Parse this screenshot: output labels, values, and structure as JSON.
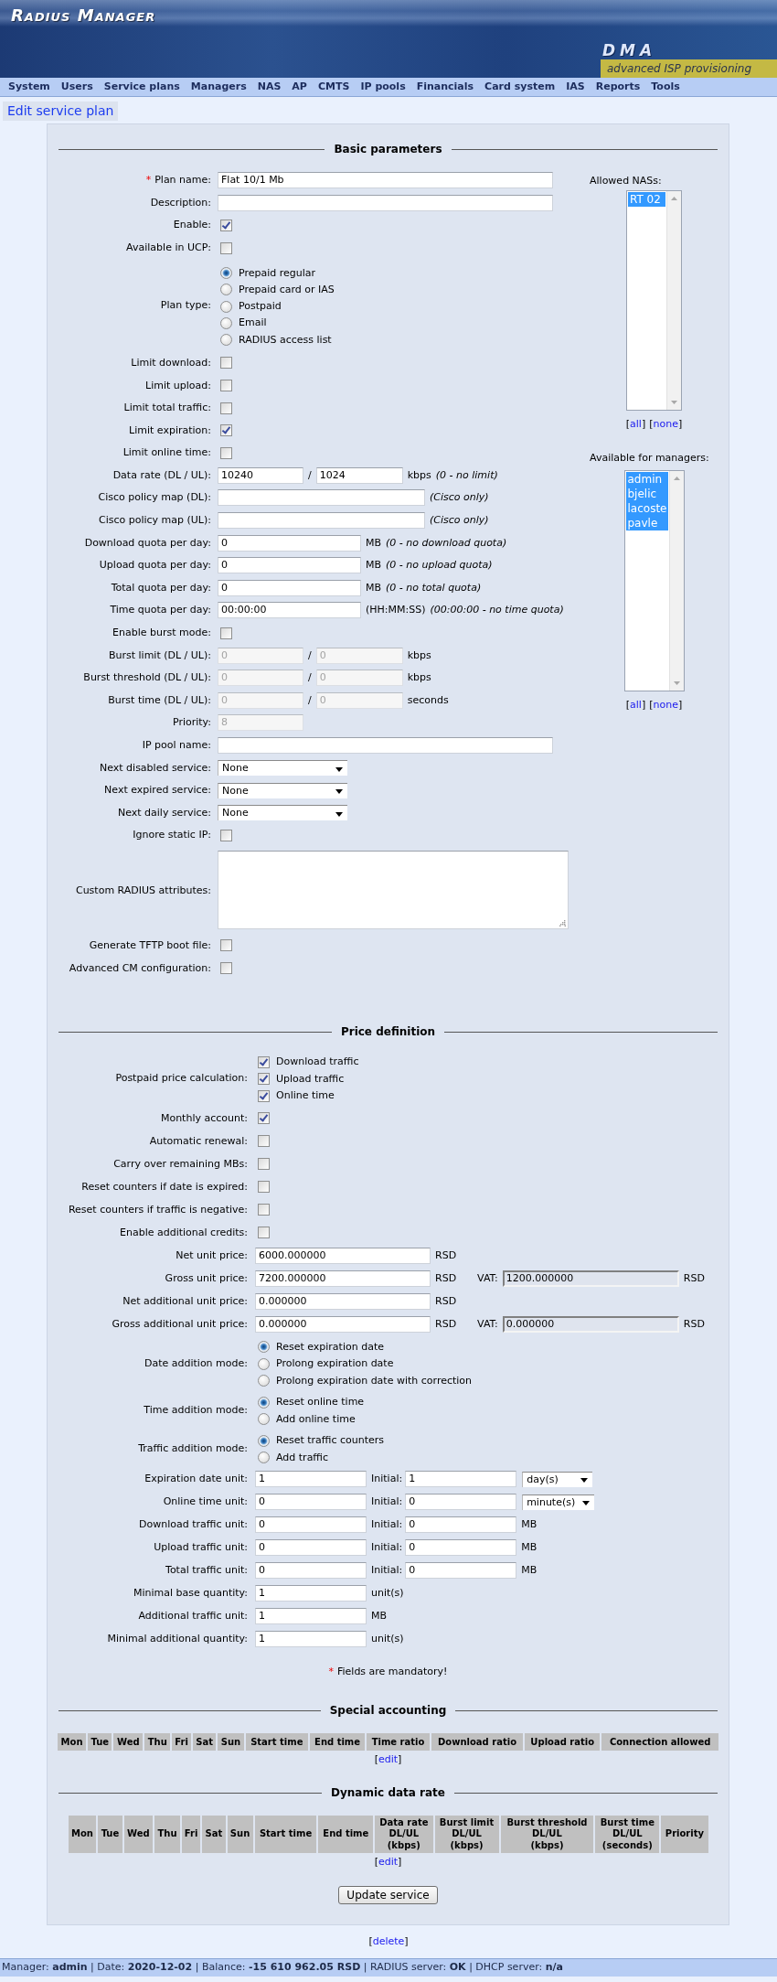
{
  "header": {
    "title": "Radius Manager",
    "logo": "DMA",
    "tagline": "advanced ISP provisioning"
  },
  "menu": [
    "System",
    "Users",
    "Service plans",
    "Managers",
    "NAS",
    "AP",
    "CMTS",
    "IP pools",
    "Financials",
    "Card system",
    "IAS",
    "Reports",
    "Tools"
  ],
  "page_title": "Edit service plan",
  "basic": {
    "heading": "Basic parameters",
    "rows": [
      {
        "kind": "wide",
        "label": "Plan name:",
        "mark": "*",
        "value": "Flat 10/1 Mb",
        "disabled": false
      },
      {
        "kind": "wide",
        "label": "Description:",
        "disabled": false
      },
      {
        "kind": "checkbox",
        "label": "Enable:",
        "checked": true,
        "disabled": false
      },
      {
        "kind": "checkbox",
        "label": "Available in UCP:",
        "checked": false,
        "disabled": false
      },
      {
        "kind": "radio",
        "label": "Plan type:",
        "disabled": false,
        "options": [
          {
            "label": "Prepaid regular",
            "selected": true
          },
          {
            "label": "Prepaid card or IAS",
            "selected": false
          },
          {
            "label": "Postpaid",
            "selected": false
          },
          {
            "label": "Email",
            "selected": false
          },
          {
            "label": "RADIUS access list",
            "selected": false
          }
        ]
      },
      {
        "kind": "checkbox",
        "label": "Limit download:",
        "checked": false,
        "disabled": false
      },
      {
        "kind": "checkbox",
        "label": "Limit upload:",
        "checked": false,
        "disabled": false
      },
      {
        "kind": "checkbox",
        "label": "Limit total traffic:",
        "checked": false,
        "disabled": false
      },
      {
        "kind": "checkbox",
        "label": "Limit expiration:",
        "checked": true,
        "disabled": false
      },
      {
        "kind": "checkbox",
        "label": "Limit online time:",
        "checked": false,
        "disabled": false
      },
      {
        "kind": "pair",
        "label": "Data rate (DL / UL):",
        "values": [
          "10240",
          "1024"
        ],
        "separator": "/",
        "unit": "kbps",
        "note": "(0 - no limit)",
        "disabled": false
      },
      {
        "kind": "medium",
        "label": "Cisco policy map (DL):",
        "note": "(Cisco only)",
        "disabled": false
      },
      {
        "kind": "medium",
        "label": "Cisco policy map (UL):",
        "note": "(Cisco only)",
        "disabled": false
      },
      {
        "kind": "quota",
        "label": "Download quota per day:",
        "value": "0",
        "unit": "MB",
        "note": "(0 - no download quota)",
        "disabled": false
      },
      {
        "kind": "quota",
        "label": "Upload quota per day:",
        "value": "0",
        "unit": "MB",
        "note": "(0 - no upload quota)",
        "disabled": false
      },
      {
        "kind": "quota",
        "label": "Total quota per day:",
        "value": "0",
        "unit": "MB",
        "note": "(0 - no total quota)",
        "disabled": false
      },
      {
        "kind": "quota",
        "label": "Time quota per day:",
        "value": "00:00:00",
        "unit": "(HH:MM:SS)",
        "note": "(00:00:00 - no time quota)",
        "disabled": false
      },
      {
        "kind": "checkbox",
        "label": "Enable burst mode:",
        "checked": false,
        "disabled": false
      },
      {
        "kind": "pair",
        "label": "Burst limit (DL / UL):",
        "values": [
          "0",
          "0"
        ],
        "separator": "/",
        "unit": "kbps",
        "disabled": true
      },
      {
        "kind": "pair",
        "label": "Burst threshold (DL / UL):",
        "values": [
          "0",
          "0"
        ],
        "separator": "/",
        "unit": "kbps",
        "disabled": true
      },
      {
        "kind": "pair",
        "label": "Burst time (DL / UL):",
        "values": [
          "0",
          "0"
        ],
        "separator": "/",
        "unit": "seconds",
        "disabled": true
      },
      {
        "kind": "short",
        "label": "Priority:",
        "value": "8",
        "disabled": true
      },
      {
        "kind": "wide",
        "label": "IP pool name:",
        "disabled": false
      },
      {
        "kind": "select",
        "label": "Next disabled service:",
        "value": "None",
        "disabled": false
      },
      {
        "kind": "select",
        "label": "Next expired service:",
        "value": "None",
        "disabled": false
      },
      {
        "kind": "select",
        "label": "Next daily service:",
        "value": "None",
        "disabled": false
      },
      {
        "kind": "checkbox",
        "label": "Ignore static IP:",
        "checked": false,
        "disabled": false
      },
      {
        "kind": "textarea",
        "label": "Custom RADIUS attributes:",
        "disabled": false
      },
      {
        "kind": "checkbox",
        "label": "Generate TFTP boot file:",
        "checked": false,
        "disabled": false
      },
      {
        "kind": "checkbox",
        "label": "Advanced CM configuration:",
        "checked": false,
        "disabled": false
      }
    ],
    "side": [
      {
        "label": "Allowed NASs:",
        "items": [
          {
            "label": "RT 02",
            "selected": true
          }
        ],
        "links": [
          {
            "before": "[",
            "label": "all",
            "after": "]"
          },
          {
            "before": "[",
            "label": "none",
            "after": "]"
          }
        ]
      },
      {
        "label": "Available for managers:",
        "items": [
          {
            "label": "admin",
            "selected": true
          },
          {
            "label": "bjelic",
            "selected": true
          },
          {
            "label": "lacoste",
            "selected": true
          },
          {
            "label": "pavle",
            "selected": true
          }
        ],
        "links": [
          {
            "before": "[",
            "label": "all",
            "after": "]"
          },
          {
            "before": "[",
            "label": "none",
            "after": "]"
          }
        ]
      }
    ]
  },
  "price": {
    "heading": "Price definition",
    "rows": [
      {
        "kind": "checks",
        "label": "Postpaid price calculation:",
        "options": [
          {
            "label": "Download traffic",
            "checked": true
          },
          {
            "label": "Upload traffic",
            "checked": true
          },
          {
            "label": "Online time",
            "checked": true
          }
        ]
      },
      {
        "kind": "checkbox",
        "label": "Monthly account:",
        "checked": true
      },
      {
        "kind": "checkbox",
        "label": "Automatic renewal:",
        "checked": false
      },
      {
        "kind": "checkbox",
        "label": "Carry over remaining MBs:",
        "checked": false
      },
      {
        "kind": "checkbox",
        "label": "Reset counters if date is expired:",
        "checked": false
      },
      {
        "kind": "checkbox",
        "label": "Reset counters if traffic is negative:",
        "checked": false
      },
      {
        "kind": "checkbox",
        "label": "Enable additional credits:",
        "checked": false
      },
      {
        "kind": "price",
        "label": "Net unit price:",
        "value": "6000.000000",
        "unit": "RSD"
      },
      {
        "kind": "vat",
        "label": "Gross unit price:",
        "value": "7200.000000",
        "unit": "RSD",
        "vat": {
          "label": "VAT:",
          "value": "1200.000000",
          "unit": "RSD"
        }
      },
      {
        "kind": "price",
        "label": "Net additional unit price:",
        "value": "0.000000",
        "unit": "RSD"
      },
      {
        "kind": "vat",
        "label": "Gross additional unit price:",
        "value": "0.000000",
        "unit": "RSD",
        "vat": {
          "label": "VAT:",
          "value": "0.000000",
          "unit": "RSD"
        }
      },
      {
        "kind": "radio",
        "label": "Date addition mode:",
        "options": [
          {
            "label": "Reset expiration date",
            "selected": true
          },
          {
            "label": "Prolong expiration date",
            "selected": false
          },
          {
            "label": "Prolong expiration date with correction",
            "selected": false
          }
        ]
      },
      {
        "kind": "radio",
        "label": "Time addition mode:",
        "options": [
          {
            "label": "Reset online time",
            "selected": true
          },
          {
            "label": "Add online time",
            "selected": false
          }
        ]
      },
      {
        "kind": "radio",
        "label": "Traffic addition mode:",
        "options": [
          {
            "label": "Reset traffic counters",
            "selected": true
          },
          {
            "label": "Add traffic",
            "selected": false
          }
        ]
      },
      {
        "kind": "units",
        "label": "Expiration date unit:",
        "value": "1",
        "initial_label": "Initial:",
        "initial": "1",
        "select": "day(s)"
      },
      {
        "kind": "units",
        "label": "Online time unit:",
        "value": "0",
        "initial_label": "Initial:",
        "initial": "0",
        "select": "minute(s)"
      },
      {
        "kind": "units",
        "label": "Download traffic unit:",
        "value": "0",
        "initial_label": "Initial:",
        "initial": "0",
        "unit": "MB"
      },
      {
        "kind": "units",
        "label": "Upload traffic unit:",
        "value": "0",
        "initial_label": "Initial:",
        "initial": "0",
        "unit": "MB"
      },
      {
        "kind": "units",
        "label": "Total traffic unit:",
        "value": "0",
        "initial_label": "Initial:",
        "initial": "0",
        "unit": "MB"
      },
      {
        "kind": "qty",
        "label": "Minimal base quantity:",
        "value": "1",
        "unit": "unit(s)"
      },
      {
        "kind": "qty",
        "label": "Additional traffic unit:",
        "value": "1",
        "unit": "MB"
      },
      {
        "kind": "qty",
        "label": "Minimal additional quantity:",
        "value": "1",
        "unit": "unit(s)"
      }
    ]
  },
  "mandatory_note": {
    "mark": "*",
    "text": "Fields are mandatory!"
  },
  "tables": [
    {
      "heading": "Special accounting",
      "columns": [
        "Mon",
        "Tue",
        "Wed",
        "Thu",
        "Fri",
        "Sat",
        "Sun",
        "Start time",
        "End time",
        "Time ratio",
        "Download ratio",
        "Upload ratio",
        "Connection allowed"
      ],
      "link": {
        "before": "[",
        "label": "edit",
        "after": "]"
      }
    },
    {
      "heading": "Dynamic data rate",
      "columns": [
        "Mon",
        "Tue",
        "Wed",
        "Thu",
        "Fri",
        "Sat",
        "Sun",
        "Start time",
        "End time",
        "Data rate\nDL/UL\n(kbps)",
        "Burst limit\nDL/UL\n(kbps)",
        "Burst threshold\nDL/UL\n(kbps)",
        "Burst time\nDL/UL\n(seconds)",
        "Priority"
      ],
      "link": {
        "before": "[",
        "label": "edit",
        "after": "]"
      }
    }
  ],
  "submit": "Update service",
  "delete_link": {
    "before": "[",
    "label": "delete",
    "after": "]"
  },
  "status_bar": "Manager: **admin** | Date: **2020-12-02** | Balance: **-15 610 962.05 RSD** | RADIUS server: **OK** | DHCP server: **n/a**"
}
